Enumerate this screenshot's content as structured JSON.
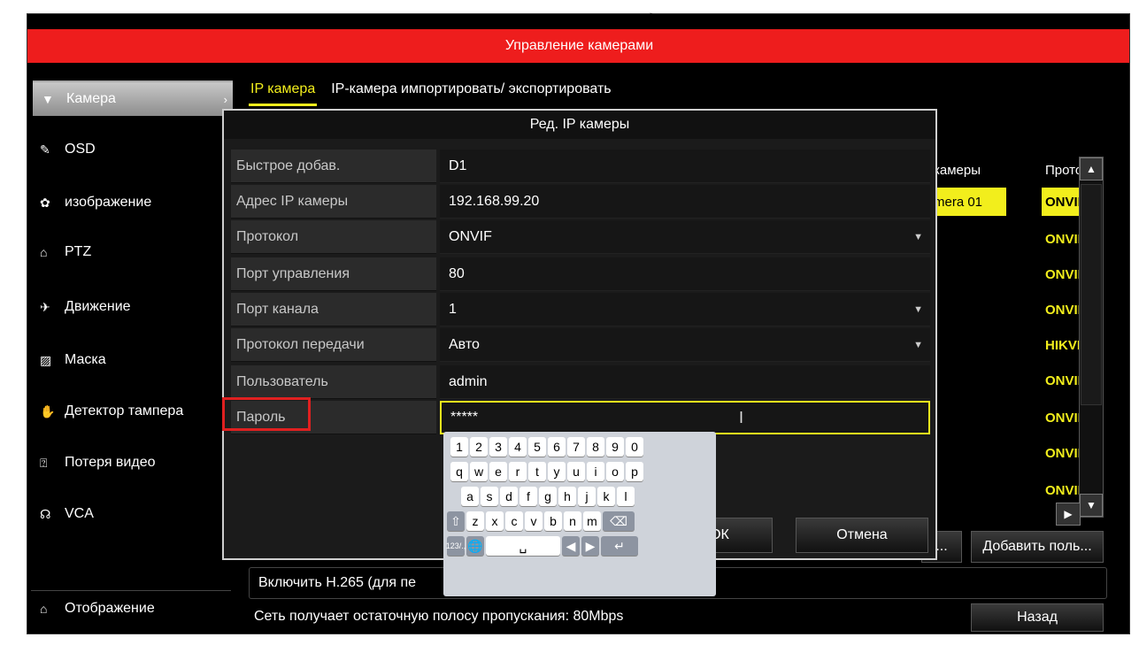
{
  "title": "Управление камерами",
  "sidebar": {
    "items": [
      {
        "icon": "camera-icon",
        "glyph": "▼",
        "label": "Камера",
        "arrow": "›"
      },
      {
        "icon": "osd-icon",
        "glyph": "✎",
        "label": "OSD"
      },
      {
        "icon": "image-icon",
        "glyph": "✿",
        "label": "изображение"
      },
      {
        "icon": "ptz-icon",
        "glyph": "⌂",
        "label": "PTZ"
      },
      {
        "icon": "motion-icon",
        "glyph": "✈",
        "label": "Движение"
      },
      {
        "icon": "mask-icon",
        "glyph": "▨",
        "label": "Маска"
      },
      {
        "icon": "tamper-icon",
        "glyph": "✋",
        "label": "Детектор тампера"
      },
      {
        "icon": "video-loss-icon",
        "glyph": "⍰",
        "label": "Потеря видео"
      },
      {
        "icon": "vca-icon",
        "glyph": "☊",
        "label": "VCA"
      }
    ],
    "footer": {
      "icon": "home-icon",
      "glyph": "⌂",
      "label": "Отображение"
    }
  },
  "tabs": [
    {
      "label": "IP камера",
      "active": true
    },
    {
      "label": "IP-камера импортировать/ экспортировать",
      "active": false
    }
  ],
  "bg_table": {
    "col_name": "камеры",
    "col_proto": "Протоі",
    "rows": [
      {
        "name": "mera 01",
        "proto": "ONVIF",
        "highlight": true
      },
      {
        "name": "",
        "proto": "ONVIF"
      },
      {
        "name": "",
        "proto": "ONVIF"
      },
      {
        "name": "",
        "proto": "ONVIF"
      },
      {
        "name": "",
        "proto": "HIKVIS"
      },
      {
        "name": "",
        "proto": "ONVIF"
      },
      {
        "name": "",
        "proto": "ONVIF"
      },
      {
        "name": "",
        "proto": "ONVIF"
      },
      {
        "name": "",
        "proto": "ONVIF"
      }
    ]
  },
  "buttons": {
    "ok": "ОК",
    "cancel": "Отмена",
    "more": "...",
    "add_user": "Добавить поль...",
    "back": "Назад"
  },
  "h265_text": "Включить H.265 (для пе",
  "bandwidth_text": "Сеть получает остаточную полосу пропускания: 80Mbps",
  "dialog": {
    "title": "Ред. IP камеры",
    "fields": [
      {
        "label": "Быстрое добав.",
        "value": "D1",
        "dropdown": false
      },
      {
        "label": "Адрес IP камеры",
        "value": "192.168.99.20",
        "dropdown": false
      },
      {
        "label": "Протокол",
        "value": "ONVIF",
        "dropdown": true
      },
      {
        "label": "Порт управления",
        "value": "80",
        "dropdown": false
      },
      {
        "label": "Порт канала",
        "value": "1",
        "dropdown": true
      },
      {
        "label": "Протокол передачи",
        "value": "Авто",
        "dropdown": true
      },
      {
        "label": "Пользователь",
        "value": "admin",
        "dropdown": false
      },
      {
        "label": "Пароль",
        "value": "*****",
        "dropdown": false,
        "focused": true
      }
    ]
  },
  "keyboard": {
    "row1": [
      "1",
      "2",
      "3",
      "4",
      "5",
      "6",
      "7",
      "8",
      "9",
      "0"
    ],
    "row2": [
      "q",
      "w",
      "e",
      "r",
      "t",
      "y",
      "u",
      "i",
      "o",
      "p"
    ],
    "row3": [
      "a",
      "s",
      "d",
      "f",
      "g",
      "h",
      "j",
      "k",
      "l"
    ],
    "row4": [
      "z",
      "x",
      "c",
      "v",
      "b",
      "n",
      "m"
    ],
    "shift": "⇧",
    "backspace": "⌫",
    "num_toggle": "123/.,",
    "globe": "🌐",
    "space": "␣",
    "left": "◀",
    "right": "▶",
    "enter": "↵"
  },
  "colors": {
    "title_bar": "#ee1d1d",
    "accent": "#f2ee1c",
    "highlight_box": "#e02020"
  }
}
